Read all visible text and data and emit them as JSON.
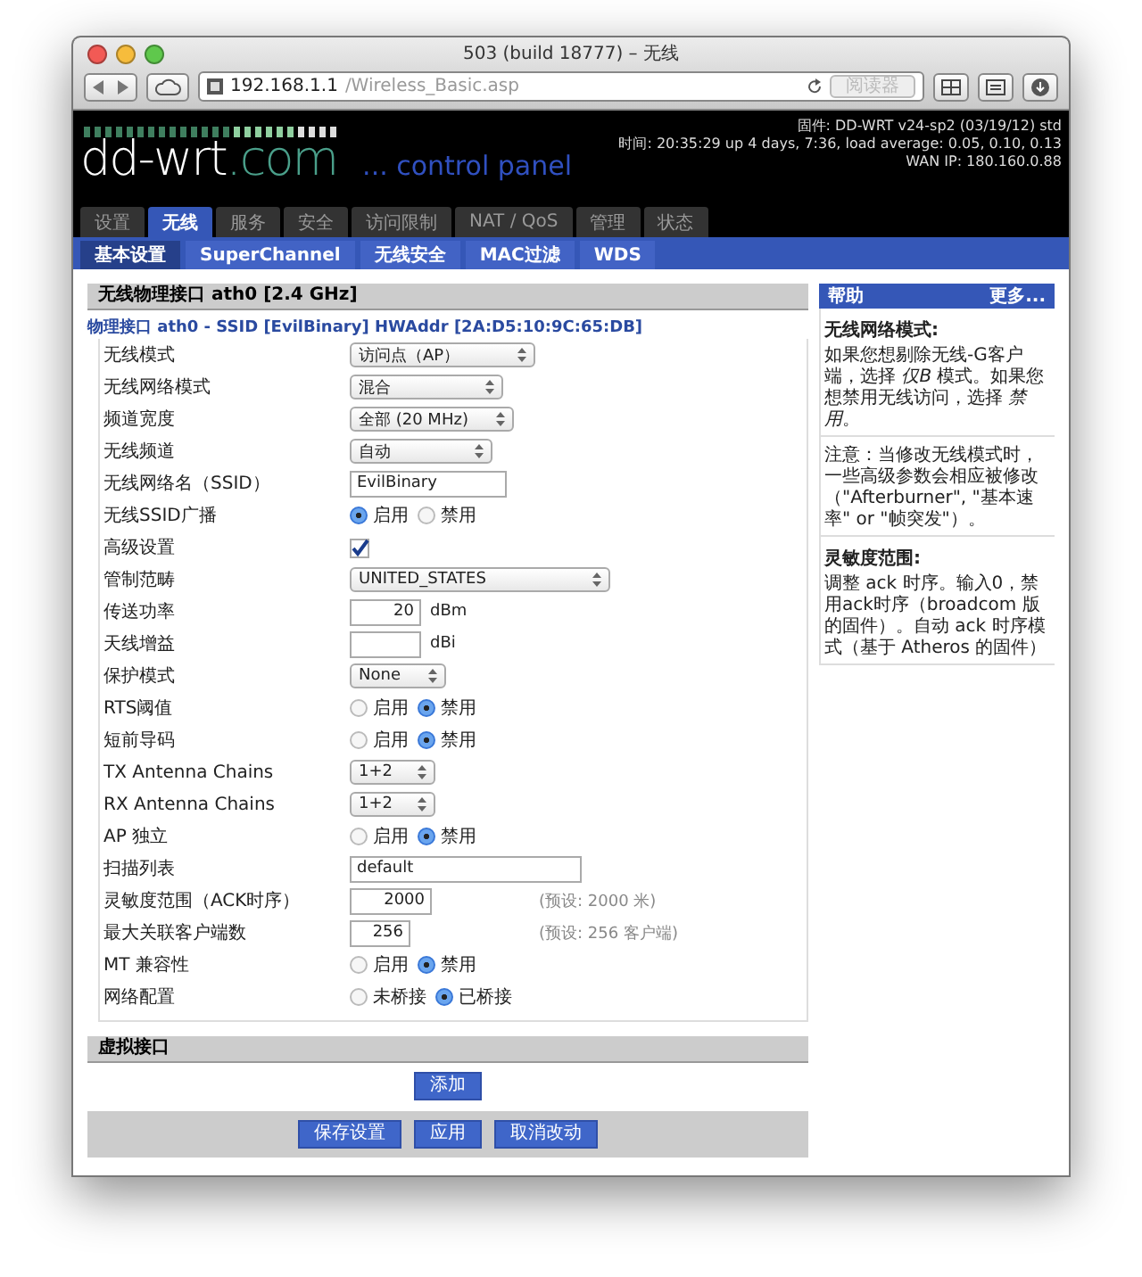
{
  "window": {
    "title": "503 (build 18777) – 无线"
  },
  "toolbar": {
    "url_host": "192.168.1.1",
    "url_path": "/Wireless_Basic.asp",
    "reader": "阅读器"
  },
  "header": {
    "logo_main": "dd-wrt",
    "logo_suffix": ".com",
    "logo_tagline": "... control panel",
    "info": [
      "固件: DD-WRT v24-sp2 (03/19/12) std",
      "时间: 20:35:29 up 4 days, 7:36, load average: 0.05, 0.10, 0.13",
      "WAN IP: 180.160.0.88"
    ]
  },
  "tabs": [
    {
      "label": "设置",
      "selected": false
    },
    {
      "label": "无线",
      "selected": true
    },
    {
      "label": "服务",
      "selected": false
    },
    {
      "label": "安全",
      "selected": false
    },
    {
      "label": "访问限制",
      "selected": false
    },
    {
      "label": "NAT / QoS",
      "selected": false
    },
    {
      "label": "管理",
      "selected": false
    },
    {
      "label": "状态",
      "selected": false
    }
  ],
  "subtabs": [
    {
      "label": "基本设置",
      "selected": true
    },
    {
      "label": "SuperChannel",
      "selected": false
    },
    {
      "label": "无线安全",
      "selected": false
    },
    {
      "label": "MAC过滤",
      "selected": false
    },
    {
      "label": "WDS",
      "selected": false
    }
  ],
  "section_title": "无线物理接口 ath0 [2.4 GHz]",
  "legend": "物理接口 ath0 - SSID [EvilBinary] HWAddr [2A:D5:10:9C:65:DB]",
  "rows": [
    {
      "label": "无线模式",
      "kind": "select",
      "value": "访问点（AP）"
    },
    {
      "label": "无线网络模式",
      "kind": "select",
      "value": "混合"
    },
    {
      "label": "频道宽度",
      "kind": "select",
      "value": "全部 (20 MHz)"
    },
    {
      "label": "无线频道",
      "kind": "select",
      "value": "自动"
    },
    {
      "label": "无线网络名（SSID）",
      "kind": "text",
      "value": "EvilBinary"
    },
    {
      "label": "无线SSID广播",
      "kind": "radio",
      "options": [
        {
          "label": "启用",
          "selected": true
        },
        {
          "label": "禁用",
          "selected": false
        }
      ]
    },
    {
      "label": "高级设置",
      "kind": "checkbox",
      "checked": true
    },
    {
      "label": "管制范畴",
      "kind": "select",
      "value": "UNITED_STATES"
    },
    {
      "label": "传送功率",
      "kind": "number",
      "value": "20",
      "unit": "dBm"
    },
    {
      "label": "天线增益",
      "kind": "number",
      "unit": "dBi"
    },
    {
      "label": "保护模式",
      "kind": "select",
      "value": "None"
    },
    {
      "label": "RTS阈值",
      "kind": "radio",
      "options": [
        {
          "label": "启用",
          "selected": false
        },
        {
          "label": "禁用",
          "selected": true
        }
      ]
    },
    {
      "label": "短前导码",
      "kind": "radio",
      "options": [
        {
          "label": "启用",
          "selected": false
        },
        {
          "label": "禁用",
          "selected": true
        }
      ]
    },
    {
      "label": "TX Antenna Chains",
      "kind": "select",
      "value": "1+2"
    },
    {
      "label": "RX Antenna Chains",
      "kind": "select",
      "value": "1+2"
    },
    {
      "label": "AP 独立",
      "kind": "radio",
      "options": [
        {
          "label": "启用",
          "selected": false
        },
        {
          "label": "禁用",
          "selected": true
        }
      ]
    },
    {
      "label": "扫描列表",
      "kind": "text",
      "value": "default"
    },
    {
      "label": "灵敏度范围（ACK时序）",
      "kind": "number",
      "value": "2000",
      "hint": "(预设: 2000 米)"
    },
    {
      "label": "最大关联客户端数",
      "kind": "number",
      "value": "256",
      "hint": "(预设: 256 客户端)"
    },
    {
      "label": "MT 兼容性",
      "kind": "radio",
      "options": [
        {
          "label": "启用",
          "selected": false
        },
        {
          "label": "禁用",
          "selected": true
        }
      ]
    },
    {
      "label": "网络配置",
      "kind": "radio",
      "options": [
        {
          "label": "未桥接",
          "selected": false
        },
        {
          "label": "已桥接",
          "selected": true
        }
      ]
    }
  ],
  "virtual_title": "虚拟接口",
  "add_button": "添加",
  "buttons": [
    "保存设置",
    "应用",
    "取消改动"
  ],
  "help": {
    "title": "帮助",
    "more": "更多...",
    "sections": [
      {
        "heading": "无线网络模式:",
        "text": "如果您想剔除无线-G客户端，选择 *仅B* 模式。如果您想禁用无线访问，选择 *禁用*。"
      },
      {
        "text": "注意：当修改无线模式时，一些高级参数会相应被修改（\"Afterburner\", \"基本速率\" or \"帧突发\"）。"
      },
      {
        "heading": "灵敏度范围:",
        "text": "调整 ack 时序。输入0，禁用ack时序（broadcom 版的固件）。自动 ack 时序模式（基于 Atheros 的固件）"
      }
    ]
  }
}
